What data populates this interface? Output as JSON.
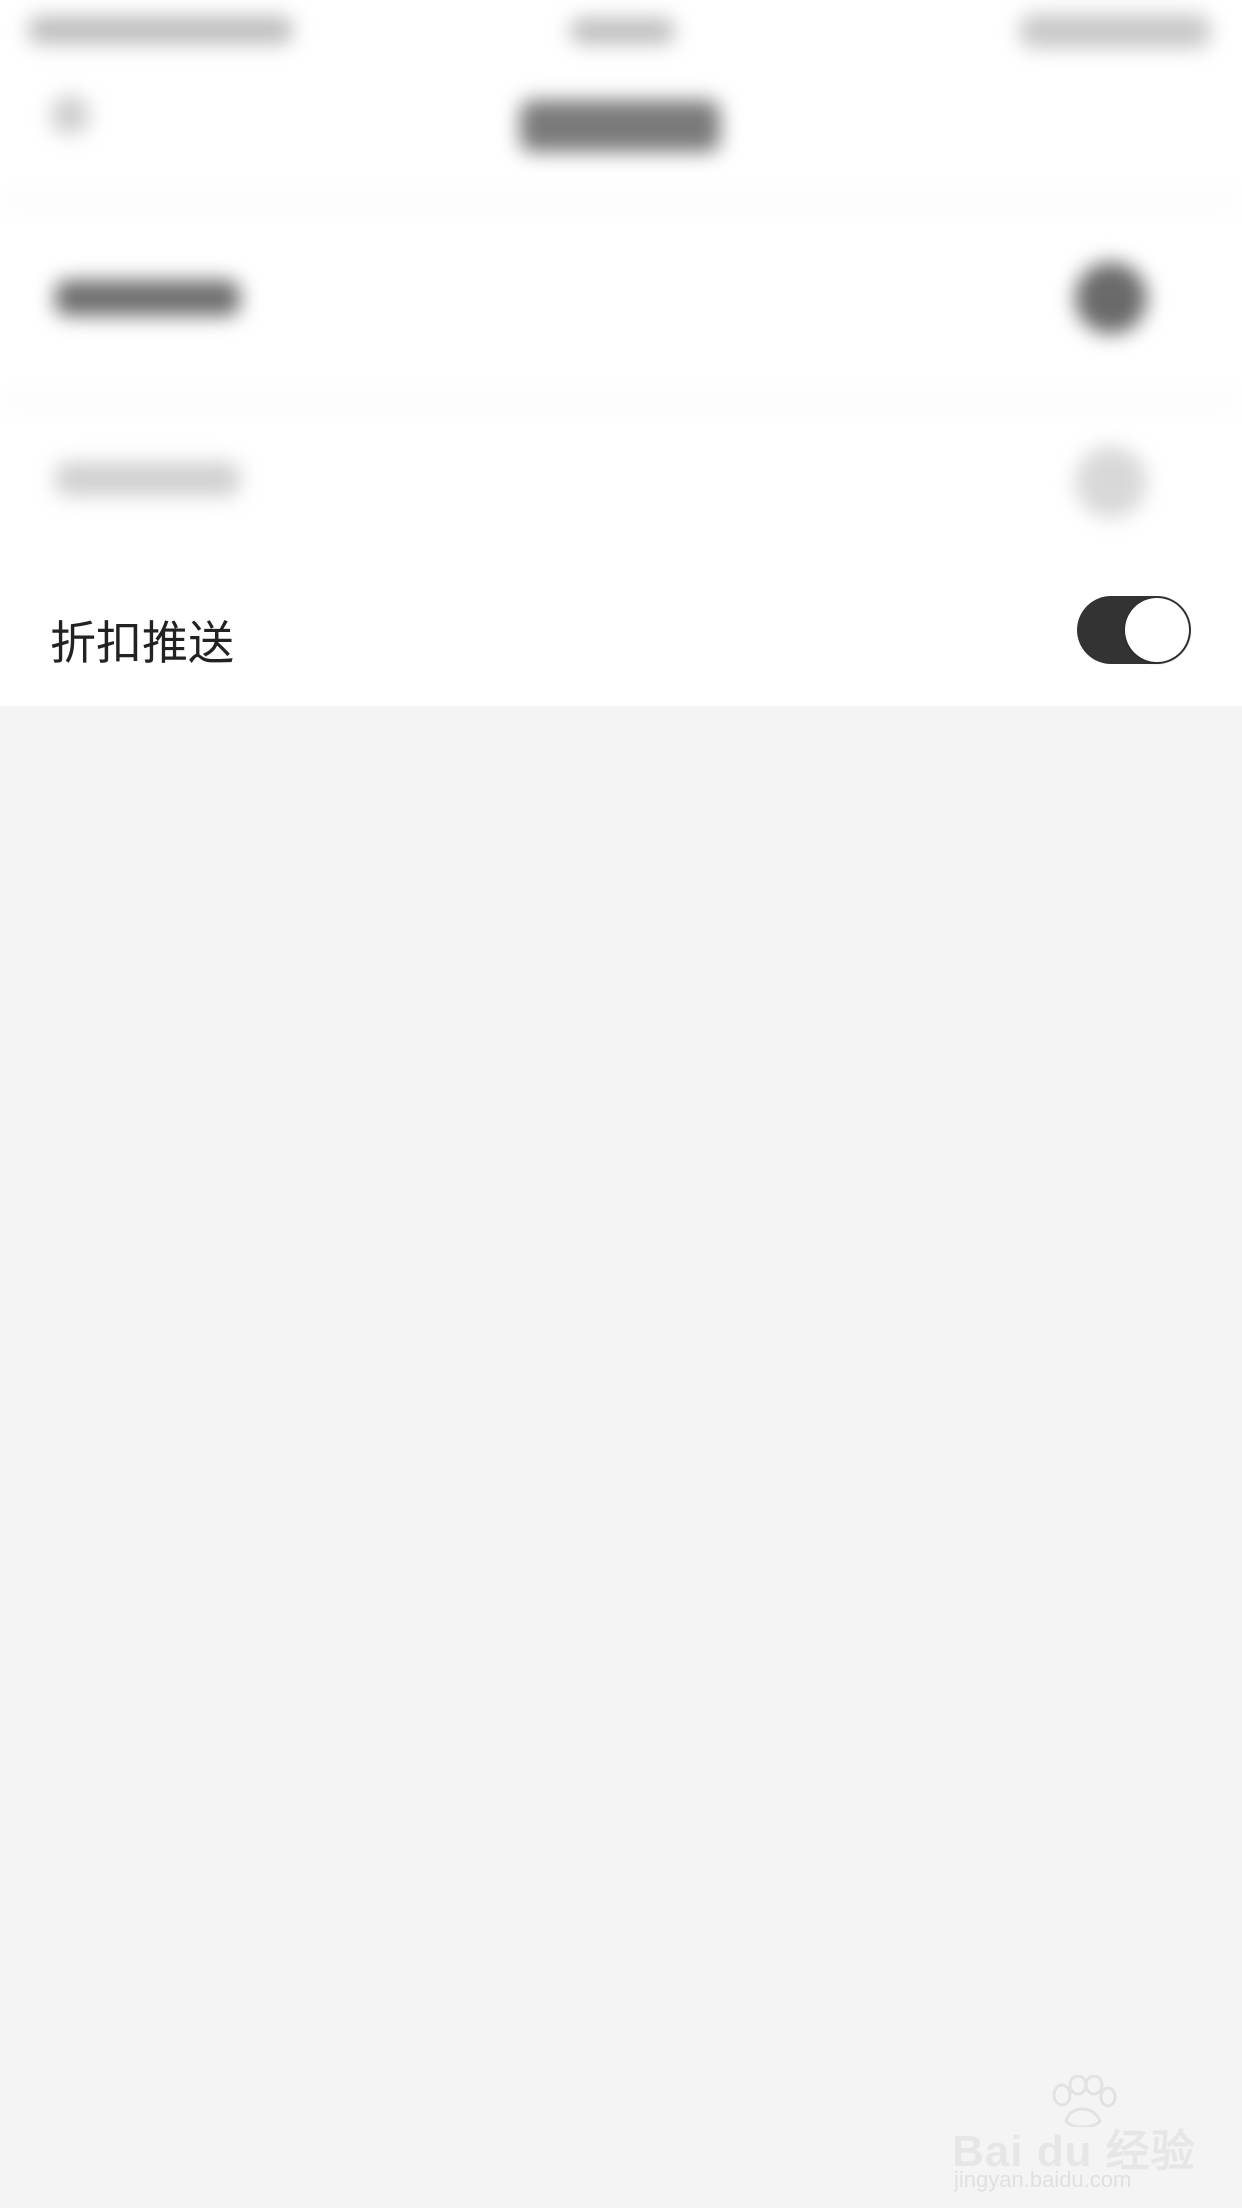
{
  "setting_row": {
    "label": "折扣推送",
    "toggle_on": true
  },
  "watermark": {
    "brand": "Bai du 经验",
    "url": "jingyan.baidu.com"
  },
  "colors": {
    "background": "#f4f4f4",
    "row_background": "#ffffff",
    "toggle_on": "#333333",
    "toggle_knob": "#ffffff",
    "label_text": "#222222"
  },
  "icons": [
    "back-arrow-icon",
    "toggle-switch",
    "baidu-paw-icon"
  ]
}
